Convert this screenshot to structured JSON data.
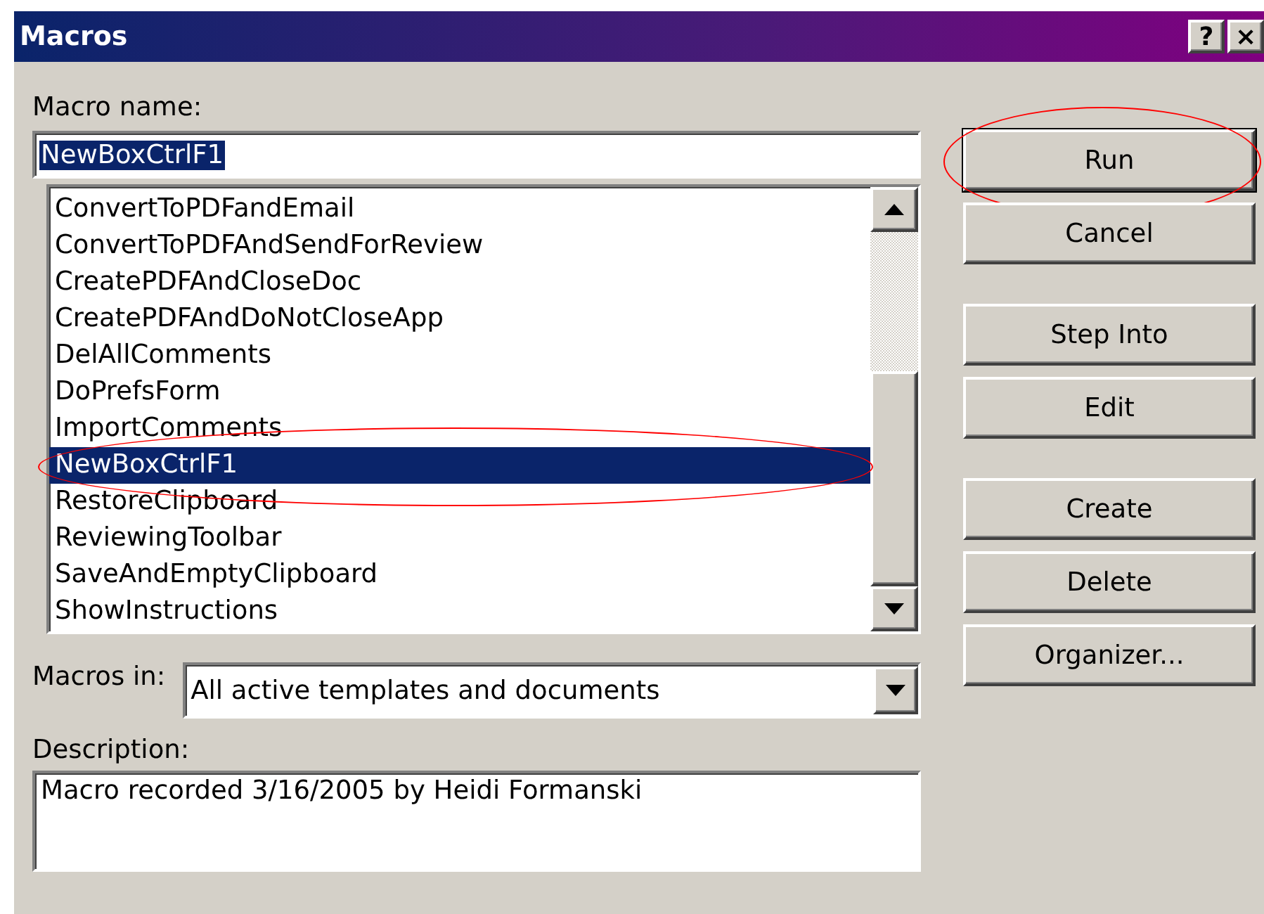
{
  "window": {
    "title": "Macros",
    "title_buttons": [
      "?",
      "×"
    ]
  },
  "macro_name": {
    "label": "Macro name:",
    "value": "NewBoxCtrlF1",
    "text_selected": true
  },
  "macro_list": {
    "items": [
      {
        "label": "ConvertToPDFandEmail",
        "selected": false,
        "highlight": false
      },
      {
        "label": "ConvertToPDFAndSendForReview",
        "selected": false,
        "highlight": false
      },
      {
        "label": "CreatePDFAndCloseDoc",
        "selected": false,
        "highlight": false
      },
      {
        "label": "CreatePDFAndDoNotCloseApp",
        "selected": false,
        "highlight": false
      },
      {
        "label": "DelAllComments",
        "selected": false,
        "highlight": false
      },
      {
        "label": "DoPrefsForm",
        "selected": false,
        "highlight": false
      },
      {
        "label": "ImportComments",
        "selected": false,
        "highlight": false
      },
      {
        "label": "NewBoxCtrlF1",
        "selected": true,
        "highlight": true
      },
      {
        "label": "RestoreClipboard",
        "selected": false,
        "highlight": false
      },
      {
        "label": "ReviewingToolbar",
        "selected": false,
        "highlight": false
      },
      {
        "label": "SaveAndEmptyClipboard",
        "selected": false,
        "highlight": false
      },
      {
        "label": "ShowInstructions",
        "selected": false,
        "highlight": false
      }
    ]
  },
  "button_groups": [
    {
      "buttons": [
        {
          "label": "Run",
          "default": true,
          "highlight": true
        },
        {
          "label": "Cancel",
          "default": false,
          "highlight": false
        }
      ]
    },
    {
      "buttons": [
        {
          "label": "Step Into",
          "default": false,
          "highlight": false
        },
        {
          "label": "Edit",
          "default": false,
          "highlight": false
        }
      ]
    },
    {
      "buttons": [
        {
          "label": "Create",
          "default": false,
          "highlight": false
        },
        {
          "label": "Delete",
          "default": false,
          "highlight": false
        },
        {
          "label": "Organizer...",
          "default": false,
          "highlight": false
        }
      ]
    }
  ],
  "macros_in": {
    "label": "Macros in:",
    "value": "All active templates and documents"
  },
  "description": {
    "label": "Description:",
    "value": "Macro recorded 3/16/2005 by Heidi Formanski"
  }
}
